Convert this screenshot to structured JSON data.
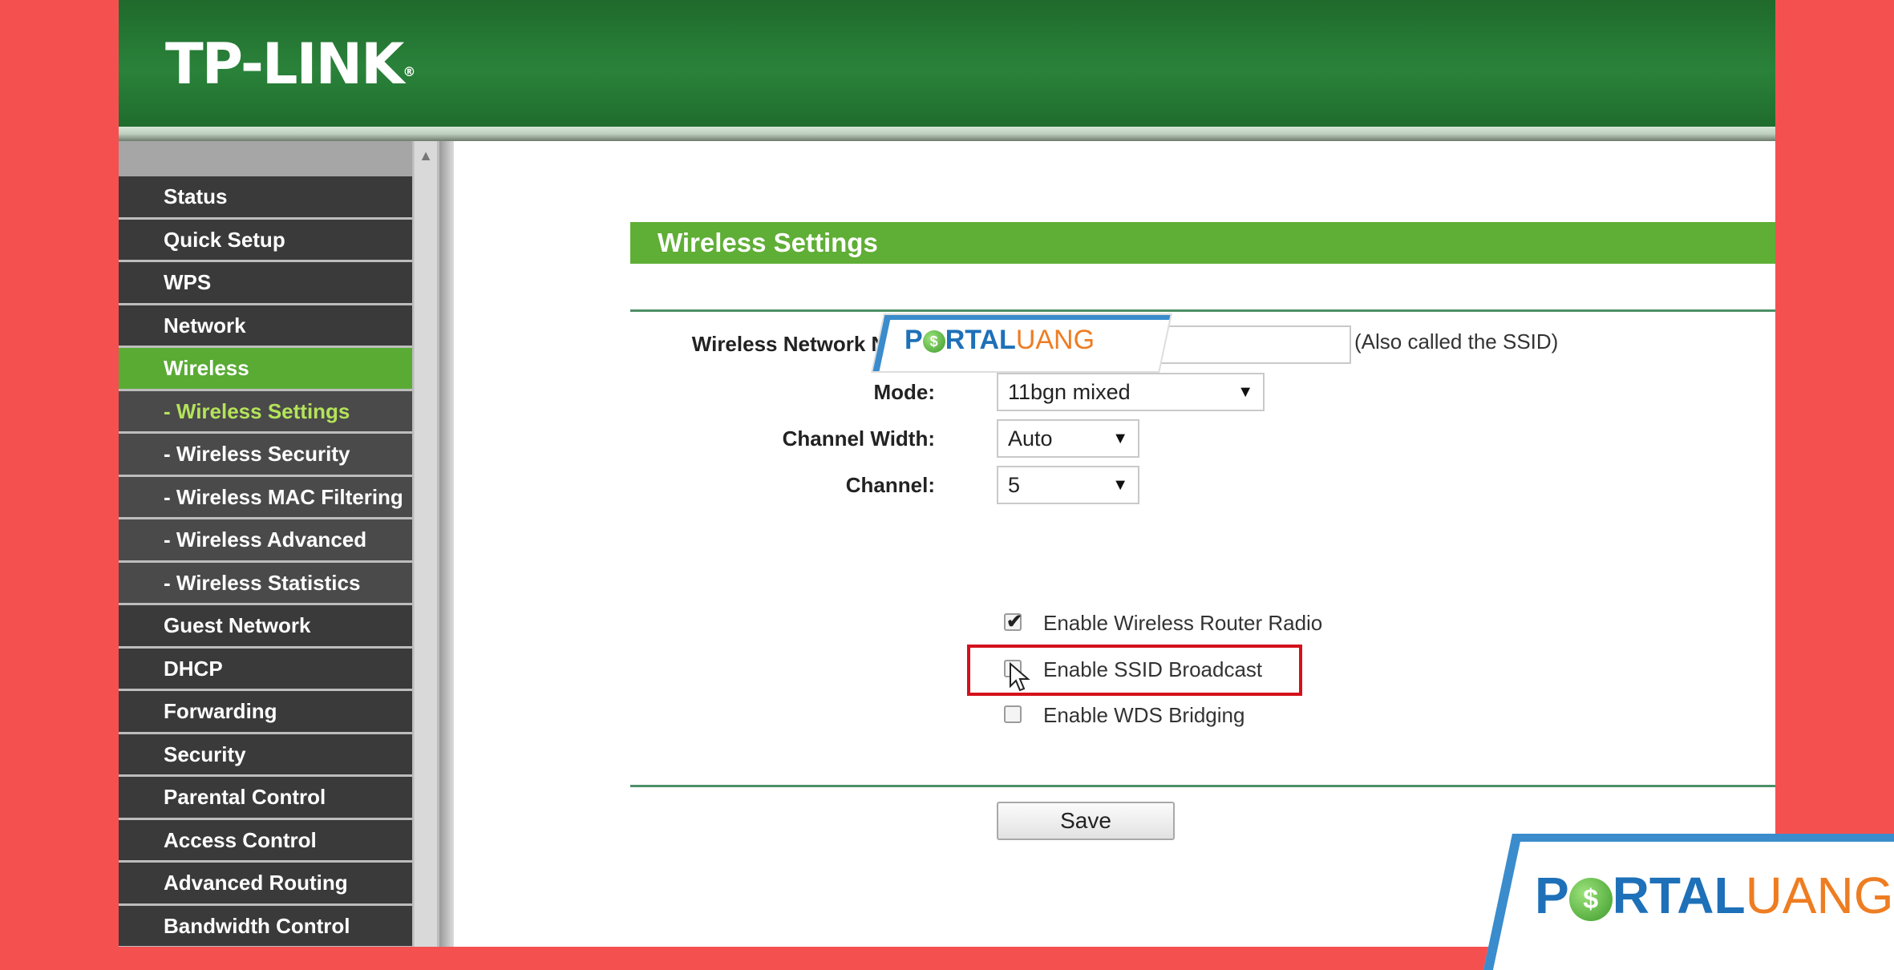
{
  "brand": {
    "logo": "TP-LINK",
    "logo_mark": "®"
  },
  "sidebar": {
    "items": [
      {
        "label": "Status"
      },
      {
        "label": "Quick Setup"
      },
      {
        "label": "WPS"
      },
      {
        "label": "Network"
      },
      {
        "label": "Wireless"
      },
      {
        "label": "- Wireless Settings"
      },
      {
        "label": "- Wireless Security"
      },
      {
        "label": "- Wireless MAC Filtering"
      },
      {
        "label": "- Wireless Advanced"
      },
      {
        "label": "- Wireless Statistics"
      },
      {
        "label": "Guest Network"
      },
      {
        "label": "DHCP"
      },
      {
        "label": "Forwarding"
      },
      {
        "label": "Security"
      },
      {
        "label": "Parental Control"
      },
      {
        "label": "Access Control"
      },
      {
        "label": "Advanced Routing"
      },
      {
        "label": "Bandwidth Control"
      }
    ]
  },
  "main": {
    "title": "Wireless Settings",
    "fields": {
      "network_name": {
        "label": "Wireless Network Name:",
        "value": "",
        "note": "(Also called the SSID)"
      },
      "mode": {
        "label": "Mode:",
        "value": "11bgn mixed"
      },
      "channel_width": {
        "label": "Channel Width:",
        "value": "Auto"
      },
      "channel": {
        "label": "Channel:",
        "value": "5"
      }
    },
    "checkboxes": [
      {
        "label": "Enable Wireless Router Radio",
        "checked": true
      },
      {
        "label": "Enable SSID Broadcast",
        "checked": false
      },
      {
        "label": "Enable WDS Bridging",
        "checked": false
      }
    ],
    "save_label": "Save"
  },
  "watermark": {
    "part1": "P",
    "part2": "RTAL",
    "part3": "UANG",
    "coin": "$"
  },
  "colors": {
    "accent_green": "#5fae35",
    "header_green": "#2a823a",
    "highlight_red": "#d4111b",
    "background_red": "#f55050"
  }
}
